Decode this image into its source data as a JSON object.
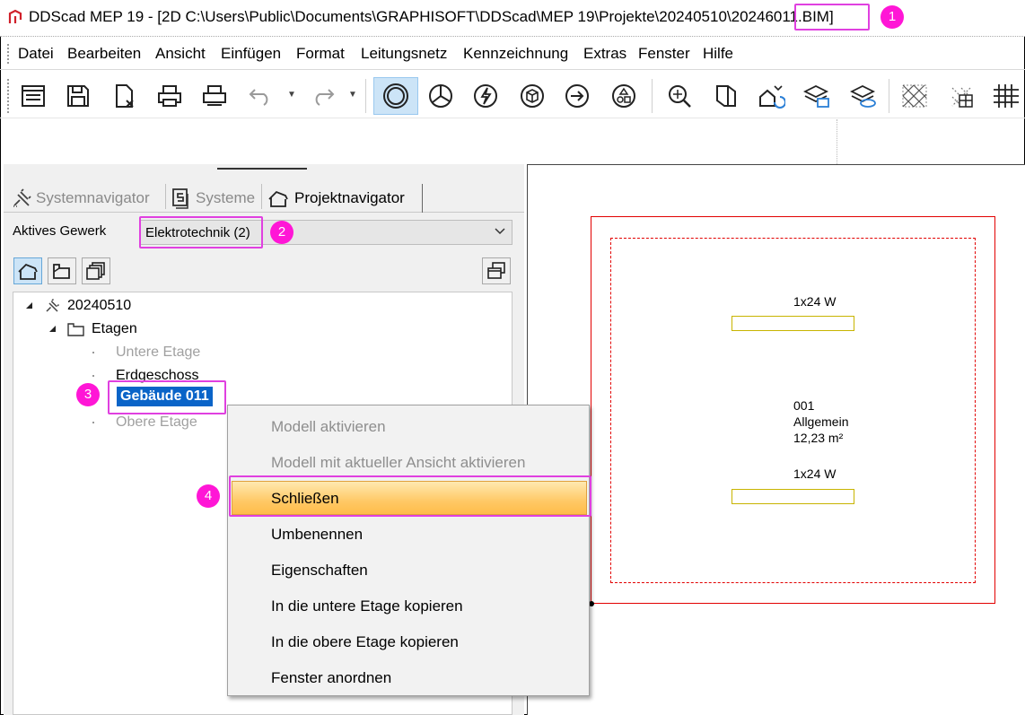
{
  "window": {
    "title_main": "DDScad MEP 19 - [2D  C:\\Users\\Public\\Documents\\GRAPHISOFT\\DDScad\\MEP 19\\Projekte\\20240510\\2024",
    "title_file": "6011.BIM",
    "title_tail": "]",
    "logo_icon": "ddscad-logo-icon"
  },
  "menubar": {
    "items": [
      "Datei",
      "Bearbeiten",
      "Ansicht",
      "Einfügen",
      "Format",
      "Leitungsnetz",
      "Kennzeichnung",
      "Extras",
      "Fenster",
      "Hilfe"
    ]
  },
  "toolbar": {
    "buttons": [
      "properties-icon",
      "save-icon",
      "close-document-icon",
      "print-icon",
      "print-preview-icon",
      "undo-icon",
      "redo-icon",
      "circle-view-icon",
      "pie-icon",
      "electric-icon",
      "cube-icon",
      "arrow-right-icon",
      "shapes-icon",
      "zoom-icon",
      "3d-view-icon",
      "building-sync-icon",
      "layers-icon",
      "layers-edit-icon",
      "hatch-icon",
      "grid-icon",
      "table-grid-icon"
    ]
  },
  "left_panel": {
    "tabs": [
      {
        "label": "Systemnavigator",
        "icon": "plug-icon",
        "active": false
      },
      {
        "label": "Systeme",
        "icon": "systems-icon",
        "active": false
      },
      {
        "label": "Projektnavigator",
        "icon": "building-icon",
        "active": true
      }
    ],
    "active_trade_label": "Aktives Gewerk",
    "active_trade_value": "Elektrotechnik (2)",
    "tree": {
      "root": "20240510",
      "folder": "Etagen",
      "floors": [
        "Untere Etage",
        "Erdgeschoss",
        "Gebäude 011",
        "Obere Etage"
      ]
    }
  },
  "context_menu": {
    "items": [
      {
        "label": "Modell aktivieren",
        "enabled": false
      },
      {
        "label": "Modell mit aktueller Ansicht aktivieren",
        "enabled": false
      },
      {
        "label": "Schließen",
        "enabled": true,
        "hover": true
      },
      {
        "label": "Umbenennen",
        "enabled": true
      },
      {
        "label": "Eigenschaften",
        "enabled": true
      },
      {
        "label": "In die untere Etage kopieren",
        "enabled": true
      },
      {
        "label": "In die obere Etage kopieren",
        "enabled": true
      },
      {
        "label": "Fenster anordnen",
        "enabled": true
      }
    ]
  },
  "drawing": {
    "lamp_label_1": "1x24 W",
    "room_number": "001",
    "room_name": "Allgemein",
    "room_area": "12,23 m²",
    "lamp_label_2": "1x24 W"
  },
  "annotations": {
    "badge_1": "1",
    "badge_2": "2",
    "badge_3": "3",
    "badge_4": "4",
    "highlight_color": "#e040e0",
    "badge_color": "#ff16d6"
  },
  "colors": {
    "selection": "#0a64c8",
    "hover_menu": "#ffc966",
    "room_border": "#e20000",
    "lamp_border": "#c8b400"
  }
}
